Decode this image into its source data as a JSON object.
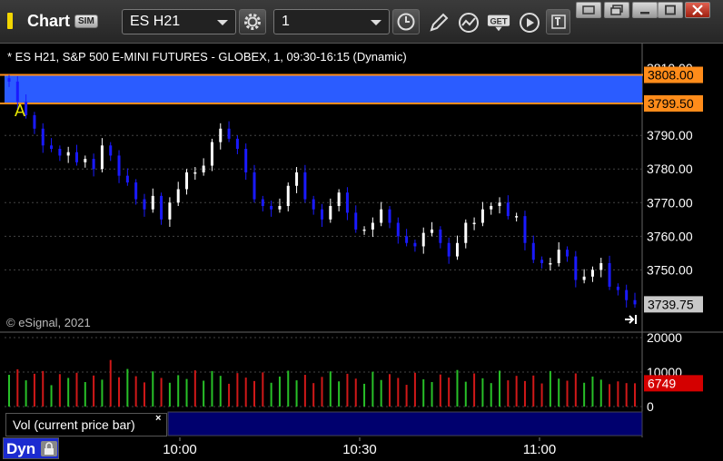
{
  "window": {
    "title": "Chart",
    "badge": "SIM",
    "symbol": "ES H21",
    "interval": "1"
  },
  "chart": {
    "info": "* ES H21, S&P 500 E-MINI FUTURES - GLOBEX, 1, 09:30-16:15 (Dynamic)",
    "watermark": "© eSignal, 2021",
    "zone_top_label": "3808.00",
    "zone_bottom_label": "3799.50",
    "last_price_label": "3739.75",
    "marker_label": "A",
    "volume_study_label": "Vol (current price bar)",
    "volume_last_label": "6749",
    "dyn_label": "Dyn",
    "close_symbol": "×"
  },
  "colors": {
    "zone": "#2b5cff",
    "zone_line": "#ff8c1a",
    "up": "#ffffff",
    "down": "#1a1aff",
    "vol_up": "#28c028",
    "vol_down": "#d01818",
    "last_vol": "#d40000",
    "axis_text": "#ffffff"
  },
  "chart_data": {
    "type": "candlestick",
    "title": "",
    "y_ticks": [
      "3810.00",
      "3800.00",
      "3790.00",
      "3780.00",
      "3770.00",
      "3760.00",
      "3750.00"
    ],
    "y_tick_values": [
      3810,
      3800,
      3790,
      3780,
      3770,
      3760,
      3750
    ],
    "x_ticks": [
      "10:00",
      "10:30",
      "11:00"
    ],
    "volume_ticks": [
      "20000",
      "10000",
      "0"
    ],
    "volume_tick_values": [
      20000,
      10000,
      0
    ],
    "ylim": [
      3736,
      3812.5
    ],
    "zone": [
      3799.5,
      3808
    ],
    "last_price": 3739.75,
    "last_volume": 6749,
    "close_series": [
      3806,
      3800,
      3796,
      3792,
      3787,
      3786,
      3784,
      3785,
      3782,
      3783,
      3780,
      3787,
      3784,
      3778,
      3776,
      3771,
      3768,
      3772,
      3765,
      3770,
      3774,
      3779,
      3779,
      3781,
      3788,
      3792,
      3789,
      3786,
      3779,
      3771,
      3769,
      3768,
      3769,
      3775,
      3779,
      3771,
      3768,
      3765,
      3769,
      3773,
      3767,
      3762,
      3762,
      3764,
      3768,
      3764,
      3760,
      3758,
      3757,
      3761,
      3762,
      3758,
      3754,
      3758,
      3764,
      3764,
      3768,
      3769,
      3770,
      3766,
      3766,
      3758,
      3753,
      3752,
      3752,
      3756,
      3754,
      3747,
      3748,
      3750,
      3752,
      3745,
      3744,
      3741,
      3739.75
    ],
    "volume_series": [
      9200,
      10800,
      7600,
      9500,
      10300,
      6200,
      9400,
      8300,
      9800,
      7100,
      9000,
      7800,
      13500,
      8500,
      10900,
      8800,
      7000,
      10200,
      8300,
      6900,
      9100,
      8000,
      10500,
      7500,
      10300,
      8900,
      6600,
      9700,
      8400,
      7400,
      9900,
      6900,
      8700,
      10400,
      7600,
      9200,
      6800,
      8600,
      10200,
      7300,
      9500,
      8100,
      6600,
      10100,
      7700,
      9400,
      8300,
      6300,
      9800,
      7900,
      7100,
      9300,
      8400,
      10600,
      7200,
      9600,
      8200,
      6800,
      10400,
      7600,
      8900,
      7400,
      9000,
      6700,
      10300,
      8100,
      7500,
      9600,
      6900,
      8700,
      7800,
      6500,
      7300,
      6800,
      6749
    ],
    "volume_up": [
      true,
      false,
      true,
      false,
      false,
      true,
      false,
      true,
      false,
      true,
      false,
      true,
      false,
      false,
      true,
      false,
      false,
      true,
      false,
      true,
      true,
      true,
      false,
      true,
      true,
      true,
      false,
      false,
      false,
      false,
      false,
      true,
      true,
      true,
      true,
      false,
      false,
      false,
      true,
      true,
      false,
      false,
      true,
      true,
      true,
      false,
      false,
      false,
      false,
      true,
      true,
      false,
      false,
      true,
      true,
      false,
      true,
      true,
      true,
      false,
      false,
      false,
      false,
      false,
      true,
      true,
      false,
      false,
      true,
      true,
      true,
      false,
      false,
      false,
      false
    ]
  }
}
